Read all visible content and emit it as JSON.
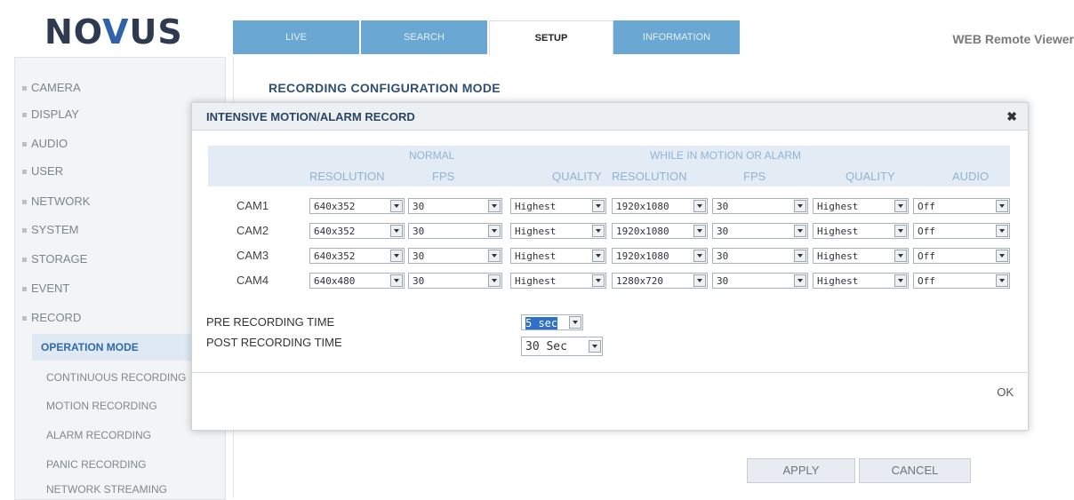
{
  "brand": {
    "logo_pre": "NO",
    "logo_v": "V",
    "logo_post": "US",
    "web_title": "WEB Remote Viewer"
  },
  "tabs": [
    {
      "label": "LIVE"
    },
    {
      "label": "SEARCH"
    },
    {
      "label": "SETUP",
      "active": true
    },
    {
      "label": "INFORMATION"
    }
  ],
  "sidebar": {
    "items": [
      "CAMERA",
      "DISPLAY",
      "AUDIO",
      "USER",
      "NETWORK",
      "SYSTEM",
      "STORAGE",
      "EVENT",
      "RECORD"
    ],
    "sub_items": [
      "OPERATION MODE",
      "CONTINUOUS RECORDING",
      "MOTION RECORDING",
      "ALARM RECORDING",
      "PANIC RECORDING",
      "NETWORK STREAMING"
    ]
  },
  "main": {
    "title": "RECORDING CONFIGURATION MODE",
    "apply_label": "APPLY",
    "cancel_label": "CANCEL"
  },
  "dialog": {
    "title": "INTENSIVE MOTION/ALARM RECORD",
    "close": "✖",
    "group_normal": "NORMAL",
    "group_motion": "WHILE IN MOTION OR ALARM",
    "columns": {
      "resolution": "RESOLUTION",
      "fps": "FPS",
      "quality": "QUALITY",
      "resolution2": "RESOLUTION",
      "fps2": "FPS",
      "quality2": "QUALITY",
      "audio": "AUDIO"
    },
    "rows": [
      {
        "cam": "CAM1",
        "res": "640x352",
        "fps": "30",
        "quality": "Highest",
        "res2": "1920x1080",
        "fps2": "30",
        "quality2": "Highest",
        "audio": "Off"
      },
      {
        "cam": "CAM2",
        "res": "640x352",
        "fps": "30",
        "quality": "Highest",
        "res2": "1920x1080",
        "fps2": "30",
        "quality2": "Highest",
        "audio": "Off"
      },
      {
        "cam": "CAM3",
        "res": "640x352",
        "fps": "30",
        "quality": "Highest",
        "res2": "1920x1080",
        "fps2": "30",
        "quality2": "Highest",
        "audio": "Off"
      },
      {
        "cam": "CAM4",
        "res": "640x480",
        "fps": "30",
        "quality": "Highest",
        "res2": "1280x720",
        "fps2": "30",
        "quality2": "Highest",
        "audio": "Off"
      }
    ],
    "pre_label": "PRE RECORDING TIME",
    "pre_value": "5 sec",
    "post_label": "POST RECORDING TIME",
    "post_value": "30 Sec",
    "ok_label": "OK"
  },
  "colors": {
    "tab_bg": "#6aa7d2",
    "accent": "#2e6aa8"
  }
}
